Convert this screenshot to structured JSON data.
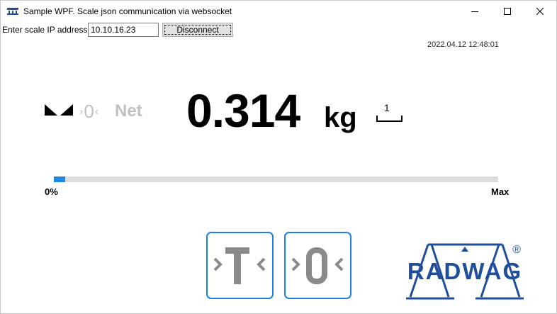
{
  "window": {
    "title": "Sample WPF. Scale json communication via websocket",
    "icon": "app-icon",
    "controls": [
      "minimize-icon",
      "maximize-icon",
      "close-icon"
    ]
  },
  "connection": {
    "label": "Enter scale IP address:",
    "ip_value": "10.10.16.23",
    "button_label": "Disconnect"
  },
  "datetime": "2022.04.12 12:48:01",
  "indicators": {
    "stability_icon": "stability-icon",
    "zero_left": "›",
    "zero_label": "0",
    "zero_right": "‹",
    "net_label": "Net"
  },
  "weight": {
    "value": "0.314",
    "unit": "kg",
    "platform_number": "1"
  },
  "progress": {
    "min_label": "0%",
    "max_label": "Max",
    "fraction": 0.025
  },
  "buttons": {
    "tare_icon": "tare-icon",
    "zero_icon": "zero-icon"
  },
  "logo": {
    "text": "RADWAG",
    "registered": "®"
  },
  "colors": {
    "accent": "#1e7fe0",
    "progress": "#1e88e5",
    "inactive": "#c0c0c0",
    "logo": "#1f4e9c"
  }
}
